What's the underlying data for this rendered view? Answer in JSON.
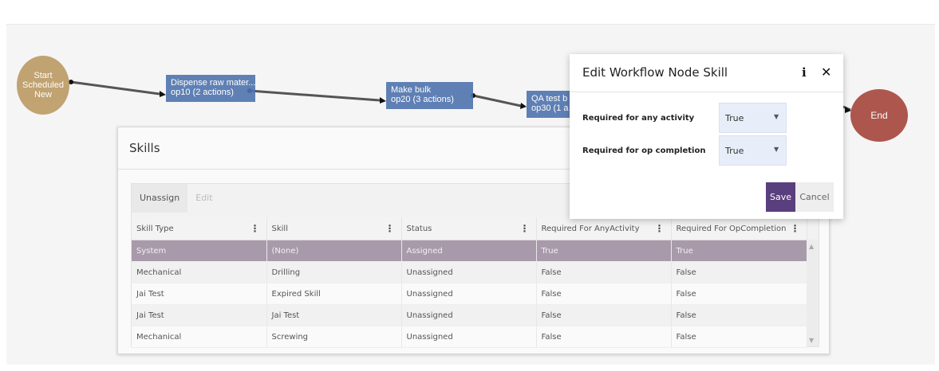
{
  "workflow": {
    "start_node_lines": [
      "Start",
      "Scheduled",
      "New"
    ],
    "end_node": "End",
    "ops": [
      {
        "name": "Dispense raw mater...",
        "sub": "op10 (2 actions)"
      },
      {
        "name": "Make bulk",
        "sub": "op20 (3 actions)"
      },
      {
        "name": "QA test b",
        "sub": "op30 (1 a"
      }
    ]
  },
  "skills": {
    "title": "Skills",
    "toolbar": {
      "unassign": "Unassign",
      "edit": "Edit"
    },
    "columns": [
      "Skill Type",
      "Skill",
      "Status",
      "Required For AnyActivity",
      "Required For OpCompletion"
    ],
    "rows": [
      [
        "System",
        "(None)",
        "Assigned",
        "True",
        "True"
      ],
      [
        "Mechanical",
        "Drilling",
        "Unassigned",
        "False",
        "False"
      ],
      [
        "Jai Test",
        "Expired Skill",
        "Unassigned",
        "False",
        "False"
      ],
      [
        "Jai Test",
        "Jai Test",
        "Unassigned",
        "False",
        "False"
      ],
      [
        "Mechanical",
        "Screwing",
        "Unassigned",
        "False",
        "False"
      ]
    ]
  },
  "modal": {
    "title": "Edit Workflow Node Skill",
    "info_icon": "info-icon",
    "close_icon": "close-icon",
    "fields": [
      {
        "label": "Required for any activity",
        "value": "True"
      },
      {
        "label": "Required for op completion",
        "value": "True"
      }
    ],
    "save": "Save",
    "cancel": "Cancel"
  },
  "colors": {
    "accent": "#5a3f7e",
    "op_node": "#4f74ad",
    "start_node": "#b8945a",
    "end_node": "#a13b30",
    "selected_row": "#a99aab"
  }
}
